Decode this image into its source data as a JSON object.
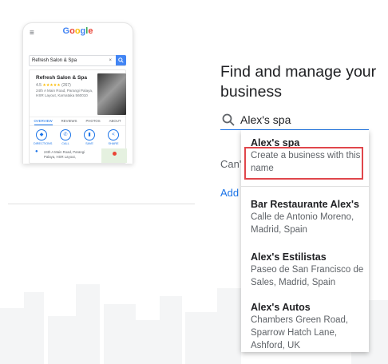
{
  "phone": {
    "menu_icon": "hamburger-icon",
    "logo": [
      "G",
      "o",
      "o",
      "g",
      "l",
      "e"
    ],
    "logo_colors": [
      "#4285f4",
      "#ea4335",
      "#fbbc05",
      "#4285f4",
      "#34a853",
      "#ea4335"
    ],
    "search_value": "Refresh Salon & Spa",
    "clear_icon": "×",
    "search_icon": "search-icon",
    "business_name": "Refresh Salon & Spa",
    "rating": "4.5",
    "stars": "★★★★★",
    "review_count": "(267)",
    "address": "24th A Main Road, Parangi Palaya, HSR Layout, Karnataka 560010",
    "tabs": [
      "OVERVIEW",
      "REVIEWS",
      "PHOTOS",
      "ABOUT"
    ],
    "actions": [
      {
        "label": "DIRECTIONS",
        "icon": "directions-icon",
        "glyph": "◆"
      },
      {
        "label": "CALL",
        "icon": "phone-icon",
        "glyph": "✆"
      },
      {
        "label": "SAVE",
        "icon": "bookmark-icon",
        "glyph": "▮"
      },
      {
        "label": "SHARE",
        "icon": "share-icon",
        "glyph": "<"
      }
    ],
    "map_address": "24th A Main Road, Parangi Palaya, HSR Layout,"
  },
  "heading": "Find and manage your business",
  "search": {
    "value": "Alex's spa",
    "icon": "search-icon"
  },
  "behind_text": {
    "cant_find": "Can't",
    "add_link": "Add"
  },
  "dropdown": {
    "items": [
      {
        "title": "Alex's spa",
        "subtitle": "Create a business with this name"
      },
      {
        "title": "Bar Restaurante Alex's",
        "subtitle": "Calle de Antonio Moreno, Madrid, Spain"
      },
      {
        "title": "Alex's Estilistas",
        "subtitle": "Paseo de San Francisco de Sales, Madrid, Spain"
      },
      {
        "title": "Alex's Autos",
        "subtitle": "Chambers Green Road, Sparrow Hatch Lane, Ashford, UK"
      }
    ]
  },
  "colors": {
    "accent": "#1a73e8",
    "highlight": "#e0464b"
  }
}
